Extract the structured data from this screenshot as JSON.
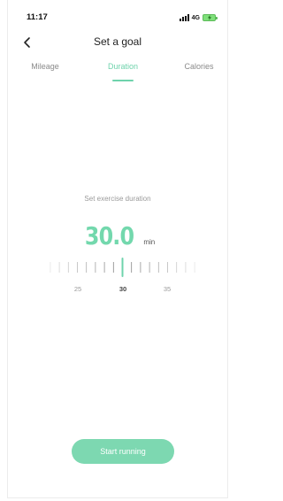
{
  "status_bar": {
    "time": "11:17",
    "network": "4G",
    "icons": [
      "signal-icon",
      "battery-charging-icon"
    ]
  },
  "header": {
    "title": "Set a goal",
    "back_icon": "chevron-left-icon"
  },
  "tabs": [
    {
      "label": "Mileage",
      "active": false
    },
    {
      "label": "Duration",
      "active": true
    },
    {
      "label": "Calories",
      "active": false
    }
  ],
  "goal": {
    "prompt": "Set exercise duration",
    "value": "30.0",
    "unit": "min"
  },
  "ruler": {
    "labels": [
      "25",
      "30",
      "35"
    ],
    "selected_label": "30"
  },
  "start_button": {
    "label": "Start running"
  },
  "colors": {
    "accent": "#6fd3ac",
    "button": "#7dd8b1",
    "muted_text": "#8a8a8a"
  }
}
